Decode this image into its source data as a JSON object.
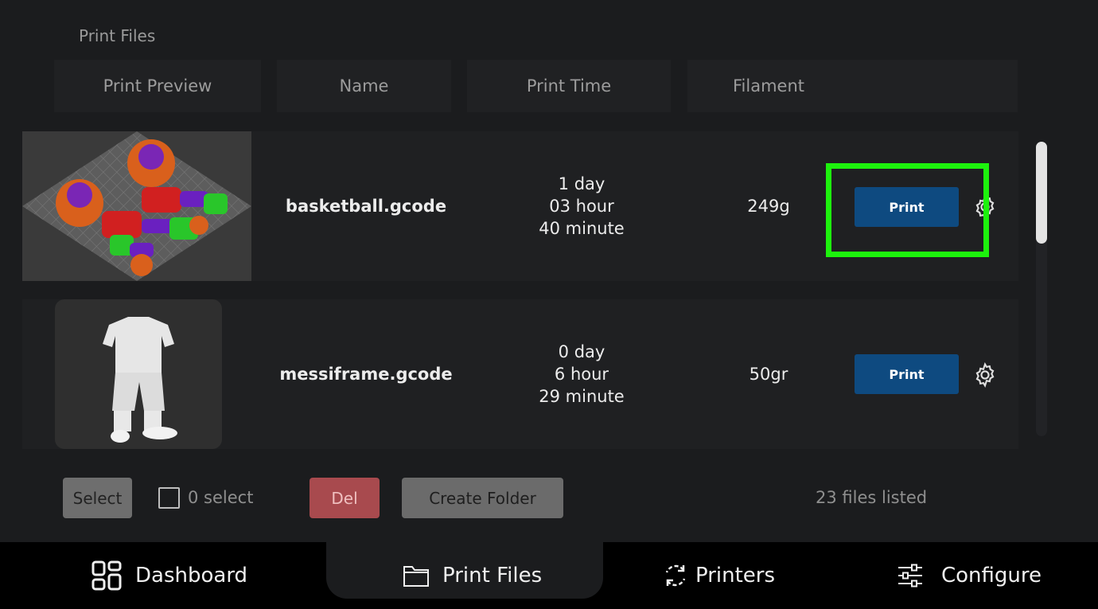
{
  "page": {
    "title": "Print Files"
  },
  "table": {
    "headers": [
      "Print Preview",
      "Name",
      "Print Time",
      "Filament"
    ],
    "rows": [
      {
        "name": "basketball.gcode",
        "time": [
          "1 day",
          "03 hour",
          "40 minute"
        ],
        "filament": "249g",
        "print_label": "Print",
        "preview": "basketball-players-preview"
      },
      {
        "name": "messiframe.gcode",
        "time": [
          "0 day",
          "6 hour",
          "29 minute"
        ],
        "filament": "50gr",
        "print_label": "Print",
        "preview": "jersey-statue-preview"
      }
    ]
  },
  "toolbar": {
    "select_label": "Select",
    "select_count": "0 select",
    "del_label": "Del",
    "create_folder_label": "Create Folder",
    "files_listed": "23 files listed"
  },
  "nav": {
    "active": "Print Files",
    "items": [
      {
        "label": "Dashboard",
        "icon": "grid-icon"
      },
      {
        "label": "Print Files",
        "icon": "folder-icon"
      },
      {
        "label": "Printers",
        "icon": "sync-icon"
      },
      {
        "label": "Configure",
        "icon": "sliders-icon"
      }
    ]
  },
  "colors": {
    "background": "#1b1c1e",
    "print_button": "#0e4a80",
    "del_button": "#a84a4e",
    "highlight": "#1df20d"
  }
}
